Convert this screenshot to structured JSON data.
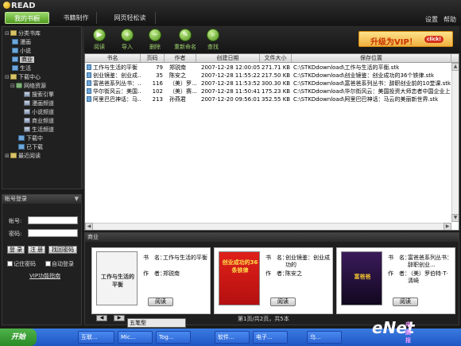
{
  "app": {
    "title": "READ"
  },
  "topnav": {
    "tabs": [
      "我的书橱",
      "书籍制作",
      "网页轻松读"
    ],
    "settings": "设置",
    "help": "帮助"
  },
  "sidebar": {
    "items": [
      {
        "label": "分类书库",
        "toggle": "⊟",
        "icon": "folder"
      },
      {
        "label": "漫画",
        "toggle": "",
        "icon": "book"
      },
      {
        "label": "小说",
        "toggle": "",
        "icon": "book"
      },
      {
        "label": "商业",
        "toggle": "",
        "icon": "book"
      },
      {
        "label": "生活",
        "toggle": "",
        "icon": "book"
      },
      {
        "label": "下载中心",
        "toggle": "⊟",
        "icon": "folder"
      },
      {
        "label": "网络资源",
        "toggle": "⊟",
        "icon": "net"
      },
      {
        "label": "搜索引擎",
        "toggle": "",
        "icon": "img"
      },
      {
        "label": "漫画频道",
        "toggle": "",
        "icon": "img"
      },
      {
        "label": "小说频道",
        "toggle": "",
        "icon": "img"
      },
      {
        "label": "商业频道",
        "toggle": "",
        "icon": "img"
      },
      {
        "label": "生活频道",
        "toggle": "",
        "icon": "img"
      },
      {
        "label": "下载中",
        "toggle": "",
        "icon": "book"
      },
      {
        "label": "已下载",
        "toggle": "",
        "icon": "book"
      },
      {
        "label": "最近阅读",
        "toggle": "⊞",
        "icon": "folder"
      }
    ]
  },
  "login": {
    "header": "帐号登录",
    "account_label": "帐号:",
    "password_label": "密码:",
    "buttons": [
      "登 录",
      "注 册",
      "找回密码"
    ],
    "remember": "记住密码",
    "auto_login": "自动登录",
    "vip_link": "VIP功能指南"
  },
  "toolbar": {
    "tools": [
      {
        "label": "阅读",
        "glyph": "▶"
      },
      {
        "label": "导入",
        "glyph": "+"
      },
      {
        "label": "删除",
        "glyph": "−"
      },
      {
        "label": "重新命名",
        "glyph": "✎"
      },
      {
        "label": "查找",
        "glyph": "⌕"
      }
    ],
    "upgrade_text": "升级为VIP！",
    "upgrade_click": "click!"
  },
  "list": {
    "columns": [
      "书名",
      "页码",
      "作者",
      "创建日期",
      "文件大小",
      "保存位置"
    ],
    "rows": [
      [
        "工作与生活的平衡",
        "79",
        "郑锐南",
        "2007-12-28 12:00:05",
        "271.71 KB",
        "C:\\STKDdownload\\工作与生活的平衡.stk"
      ],
      [
        "创业镜鉴：创业成...",
        "35",
        "陈安之",
        "2007-12-28 11:55:22",
        "217.50 KB",
        "C:\\STKDdownload\\创业镜鉴：创业成功的36个铁律.stk"
      ],
      [
        "富爸爸系列丛书：...",
        "116",
        "（美）罗...",
        "2007-12-28 11:53:52",
        "300.30 KB",
        "C:\\STKDdownload\\富爸爸系列丛书：辞职创业前的10堂课.stk"
      ],
      [
        "华尔街风云：美国...",
        "102",
        "（美）赛...",
        "2007-12-28 11:50:41",
        "175.23 KB",
        "C:\\STKDdownload\\华尔街风云：美国投资大师恋者中国企业上市.stk"
      ],
      [
        "阿里巴巴神话：马...",
        "213",
        "孙燕君",
        "2007-12-20 09:56:01",
        "352.55 KB",
        "C:\\STKDdownload\\阿里巴巴神话：马云的美丽新世界.stk"
      ]
    ]
  },
  "detail": {
    "header": "商业",
    "title_key": "书　名：",
    "author_key": "作　者：",
    "read_label": "阅读",
    "cards": [
      {
        "cover_title": "工作与生活的平衡",
        "title": "工作与生活的平衡",
        "author": "郑锐南"
      },
      {
        "cover_title": "创业成功的36条铁律",
        "title": "创业镜鉴：创业成功的",
        "author": "陈安之"
      },
      {
        "cover_title": "富爸爸",
        "title": "富爸爸系列丛书：辞职创业...",
        "author": "（美）罗伯特·T·清崎"
      }
    ],
    "pager": "第1页/共2页，共5本"
  },
  "ime": {
    "text": "五笔型"
  },
  "taskbar": {
    "start": "开始",
    "tasks": [
      "互联...",
      "Mic...",
      "Tog...",
      "软件...",
      "电子...",
      "乌..."
    ]
  },
  "watermark": {
    "brand": "Net",
    "prefix": "e",
    "sub": "电脑报"
  },
  "colors": {
    "accent_green": "#6fb530",
    "vip_orange": "#f0b040",
    "taskbar_blue": "#2d66d6"
  }
}
